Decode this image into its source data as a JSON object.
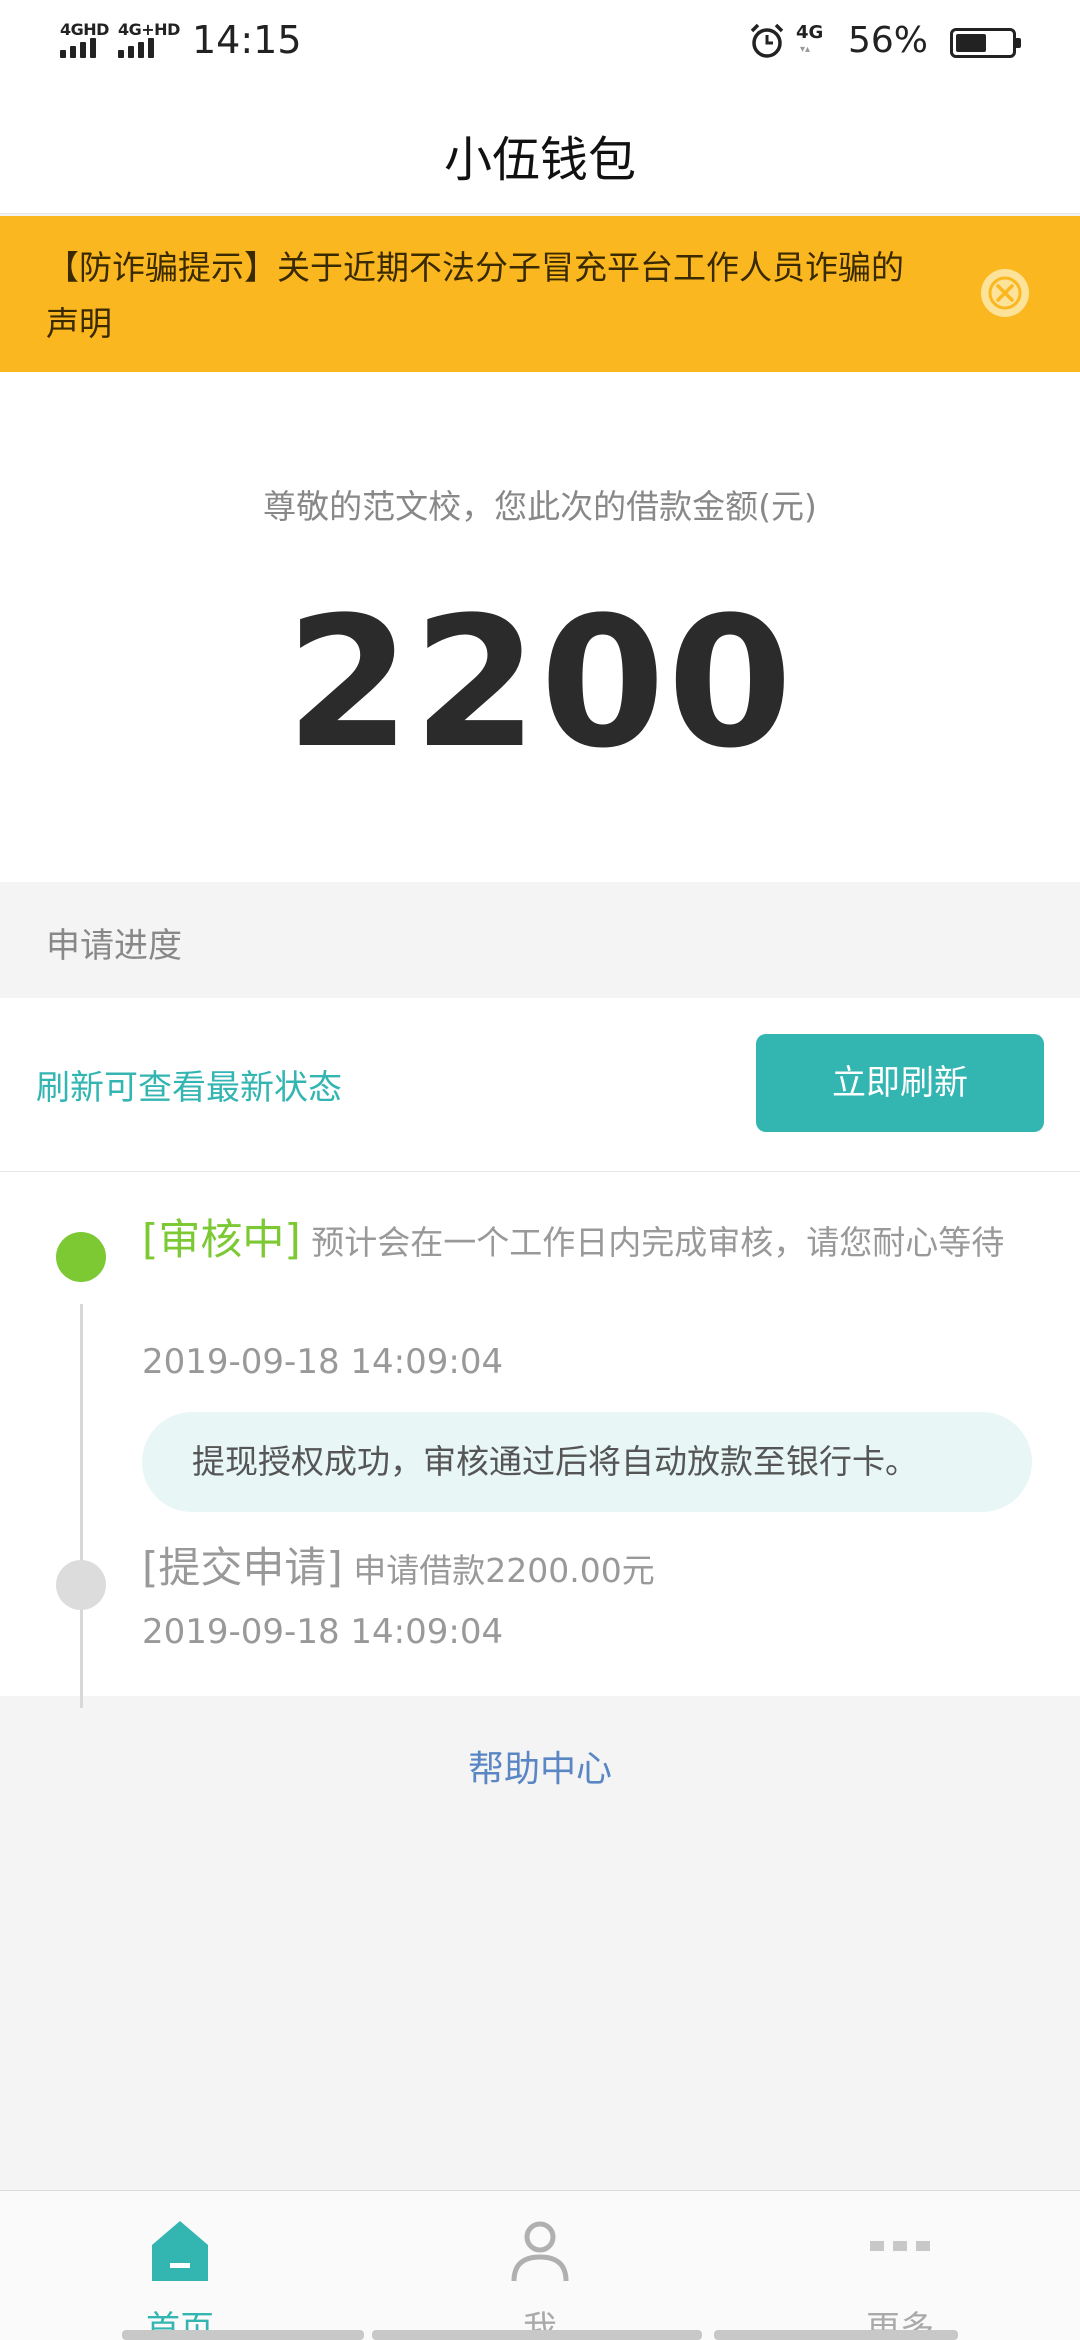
{
  "status_bar": {
    "net1": "4GHD",
    "net2": "4G+HD",
    "time": "14:15",
    "net3": "4G",
    "battery_pct_text": "56%",
    "battery_level": 0.56
  },
  "header": {
    "title": "小伍钱包"
  },
  "notice": {
    "text": "【防诈骗提示】关于近期不法分子冒充平台工作人员诈骗的声明",
    "close_icon": "close-circle-icon"
  },
  "loan": {
    "greeting": "尊敬的范文校，您此次的借款金额(元)",
    "amount": "2200"
  },
  "progress": {
    "section_label": "申请进度",
    "refresh_hint": "刷新可查看最新状态",
    "refresh_button": "立即刷新",
    "steps": [
      {
        "tag": "[审核中]",
        "desc": " 预计会在一个工作日内完成审核，请您耐心等待",
        "time": "2019-09-18 14:09:04",
        "note": "提现授权成功，审核通过后将自动放款至银行卡。",
        "color": "#7cc934"
      },
      {
        "tag": "[提交申请]",
        "desc": " 申请借款2200.00元",
        "time": "2019-09-18 14:09:04",
        "color": "#dcdcdc"
      }
    ]
  },
  "help_link": "帮助中心",
  "tabs": [
    {
      "label": "首页",
      "icon": "home-icon",
      "active": true
    },
    {
      "label": "我",
      "icon": "person-icon",
      "active": false
    },
    {
      "label": "更多",
      "icon": "more-icon",
      "active": false
    }
  ],
  "colors": {
    "accent": "#33b5b2",
    "notice": "#fbb71f",
    "success": "#7cc934",
    "link": "#5b86c4"
  }
}
